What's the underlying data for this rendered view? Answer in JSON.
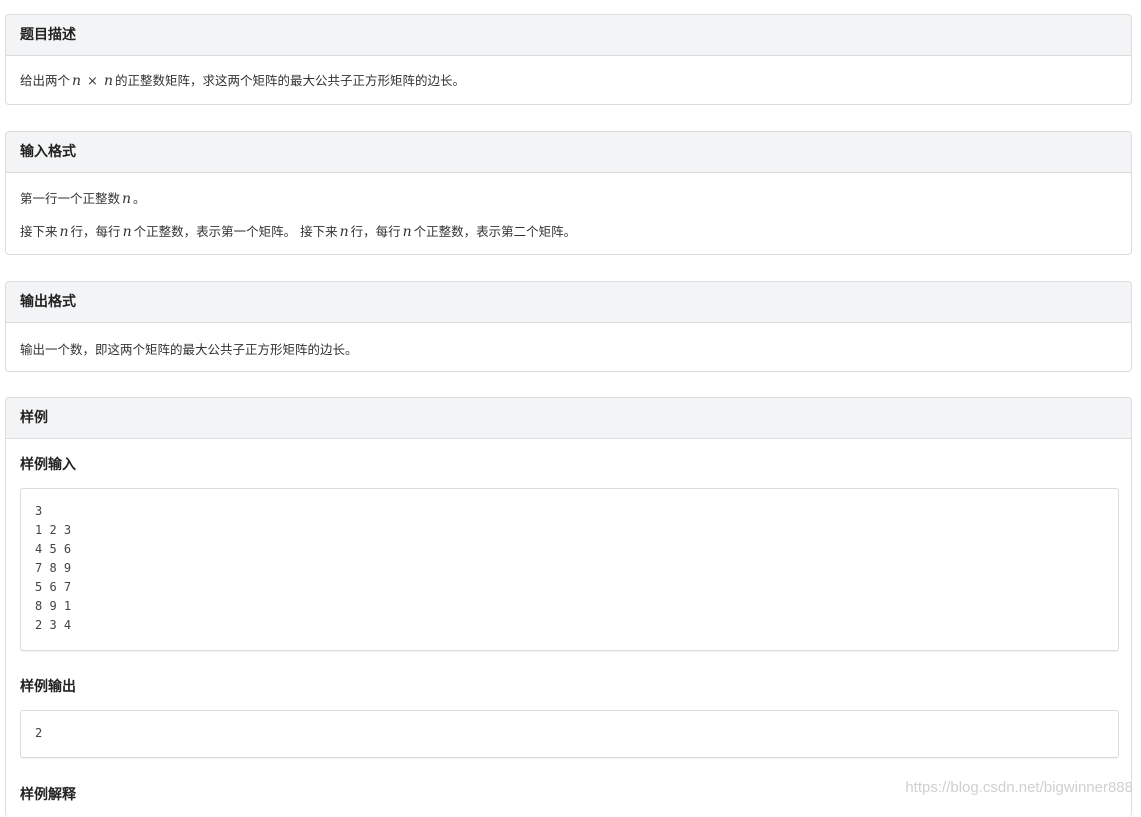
{
  "description": {
    "title": "题目描述",
    "pre": "给出两个",
    "var1": "n",
    "times": "×",
    "var2": "n",
    "post": "的正整数矩阵，求这两个矩阵的最大公共子正方形矩阵的边长。"
  },
  "input_format": {
    "title": "输入格式",
    "line1_pre": "第一行一个正整数",
    "line1_var": "n",
    "line1_post": "。",
    "line2_a": "接下来",
    "line2_var1": "n",
    "line2_b": "行，每行",
    "line2_var2": "n",
    "line2_c": "个正整数，表示第一个矩阵。 接下来",
    "line2_var3": "n",
    "line2_d": "行，每行",
    "line2_var4": "n",
    "line2_e": "个正整数，表示第二个矩阵。"
  },
  "output_format": {
    "title": "输出格式",
    "text": "输出一个数，即这两个矩阵的最大公共子正方形矩阵的边长。"
  },
  "samples": {
    "title": "样例",
    "input_title": "样例输入",
    "input_lines": [
      "3",
      "1 2 3",
      "4 5 6",
      "7 8 9",
      "5 6 7",
      "8 9 1",
      "2 3 4"
    ],
    "output_title": "样例输出",
    "output_lines": [
      "2"
    ],
    "explain_title": "样例解释"
  },
  "watermark": "https://blog.csdn.net/bigwinner888"
}
